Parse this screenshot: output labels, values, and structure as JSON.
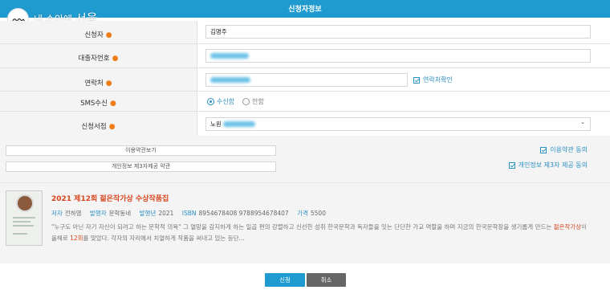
{
  "header": {
    "title": "신청자정보"
  },
  "logo": {
    "text_small": "내 손안에",
    "text_big": "서울"
  },
  "form": {
    "applicant": {
      "label": "신청자",
      "value": "김명주"
    },
    "loan_number": {
      "label": "대출자번호"
    },
    "contact": {
      "label": "연락처",
      "check_label": "연락처확인"
    },
    "sms": {
      "label": "SMS수신",
      "options": [
        "수신함",
        "안함"
      ],
      "selected": "수신함"
    },
    "library": {
      "label": "신청서점",
      "value_prefix": "노원"
    }
  },
  "terms": {
    "view_terms_button": "이용약관보기",
    "privacy_button": "개인정보 제3자제공 약관",
    "agree_terms": "이용약관 동의",
    "agree_privacy": "개인정보 제3자 제공 동의"
  },
  "book": {
    "title": "2021 제12회 젊은작가상 수상작품집",
    "author_key": "저자",
    "author": "전하영",
    "publisher_key": "발행자",
    "publisher": "문학동네",
    "year_key": "발행년",
    "year": "2021",
    "isbn_key": "ISBN",
    "isbn": "8954678408 9788954678407",
    "price_key": "가격",
    "price": "5500",
    "desc_part1": "\"누구도 아닌 자기 자신이 되려고 하는 문학적 의욕\" 그 열망을 감지하게 하는 일곱 편의 강렬하고 신선한 성취 한국문학과 독자들을 잇는 단단한 가교 역할을 하며 지금의 한국문학장을 생기롭게 만드는 ",
    "desc_hl1": "젊은작가상",
    "desc_part2": "이 올해로 ",
    "desc_hl2": "12회",
    "desc_part3": "를 맞았다. 각자의 자리에서 치열하게 작품을 써내고 있는 등단..."
  },
  "buttons": {
    "submit": "신청",
    "cancel": "취소"
  },
  "colors": {
    "accent": "#1f9bd0",
    "required": "#f07d18",
    "highlight": "#d9461e"
  }
}
